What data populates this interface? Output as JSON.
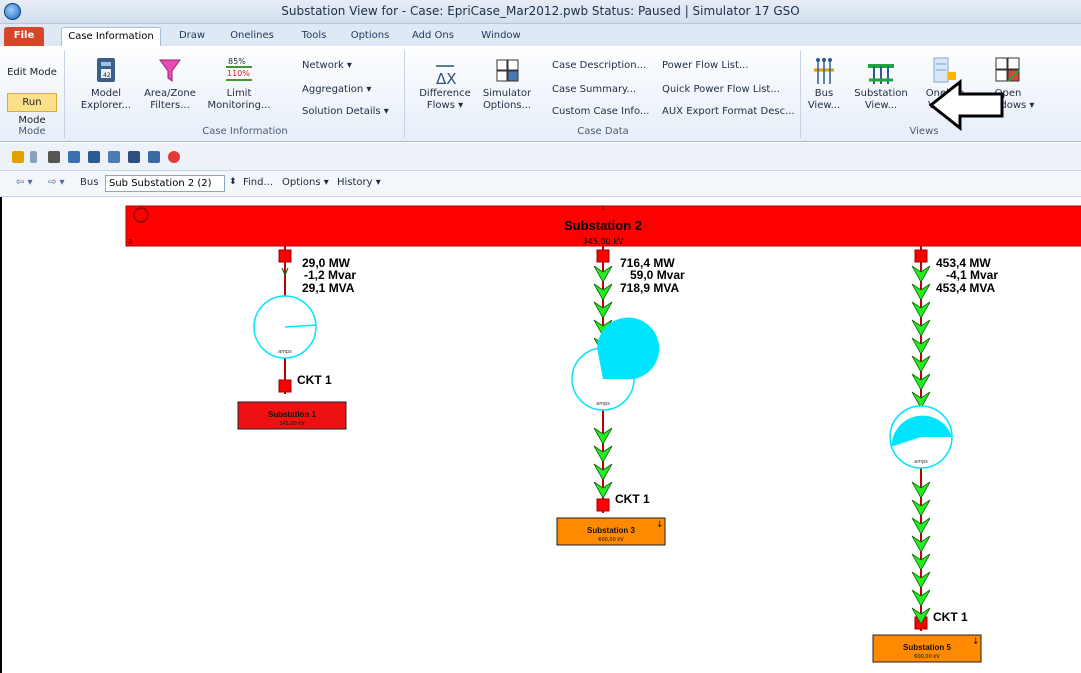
{
  "window": {
    "title": "Substation View for  - Case: EpriCase_Mar2012.pwb  Status: Paused | Simulator 17 GSO"
  },
  "ribbon_tabs": [
    "File",
    "Case Information",
    "Draw",
    "Onelines",
    "Tools",
    "Options",
    "Add Ons",
    "Window"
  ],
  "mode": {
    "edit": "Edit Mode",
    "run": "Run Mode",
    "group": "Mode"
  },
  "case_info": {
    "model_explorer_1": "Model",
    "model_explorer_2": "Explorer...",
    "area_zone_1": "Area/Zone",
    "area_zone_2": "Filters...",
    "limit_1": "Limit",
    "limit_2": "Monitoring...",
    "limit_85": "85%",
    "limit_110": "110%",
    "network": "Network  ▾",
    "aggregation": "Aggregation  ▾",
    "solution_details": "Solution Details  ▾",
    "group": "Case Information"
  },
  "case_data": {
    "difference_1": "Difference",
    "difference_2": "Flows ▾",
    "simulator_1": "Simulator",
    "simulator_2": "Options...",
    "case_description": "Case Description...",
    "case_summary": "Case Summary...",
    "custom_case_info": "Custom Case Info...",
    "power_flow_list": "Power Flow List...",
    "quick_power_flow_list": "Quick Power Flow List...",
    "aux_export": "AUX Export Format Desc...",
    "group": "Case Data"
  },
  "views": {
    "bus_1": "Bus",
    "bus_2": "View...",
    "substation_1": "Substation",
    "substation_2": "View...",
    "oneline_1": "Oneline",
    "oneline_2": "Viewer",
    "open_1": "Open",
    "open_2": "Windows ▾",
    "group": "Views"
  },
  "navbar": {
    "bus_label": "Bus",
    "bus_value": "Sub Substation 2 (2)",
    "find": "Find...",
    "options": "Options ▾",
    "history": "History ▾"
  },
  "diagram": {
    "main_bus": {
      "name": "Substation 2",
      "number": "1",
      "kv": "345,00 kV",
      "num_left": "3"
    },
    "branches": [
      {
        "mw": "29,0 MW",
        "mvar": "-1,2 Mvar",
        "mva": "29,1 MVA",
        "ckt": "CKT  1",
        "loading_pct": 28,
        "to_bus": {
          "name": "Substation 1",
          "kv": "345,00 kV",
          "color": "#ee1111"
        }
      },
      {
        "mw": "716,4 MW",
        "mvar": "59,0 Mvar",
        "mva": "718,9 MVA",
        "ckt": "CKT  1",
        "loading_pct": 72,
        "to_bus": {
          "name": "Substation 3",
          "kv": "600,00 kV",
          "color": "#ff8a00"
        }
      },
      {
        "mw": "453,4 MW",
        "mvar": "-4,1 Mvar",
        "mva": "453,4 MVA",
        "ckt": "CKT  1",
        "loading_pct": 45,
        "to_bus": {
          "name": "Substation 5",
          "kv": "600,00 kV",
          "color": "#ff8a00"
        }
      }
    ],
    "amps_label": "amps"
  },
  "colors": {
    "bus_red": "#ff0000",
    "bus_orange": "#ff8a00",
    "arrow_green": "#22ee22",
    "pie_cyan": "#00e5ff"
  }
}
